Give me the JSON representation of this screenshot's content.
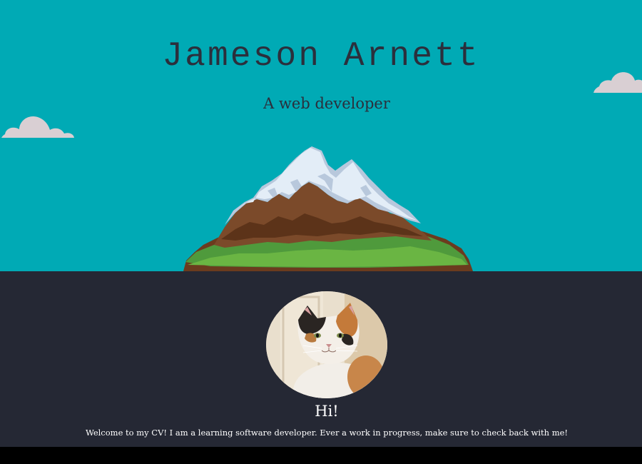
{
  "hero": {
    "name": "Jameson Arnett",
    "tagline": "A web developer",
    "background_color": "#00aab5",
    "decorations": [
      "cloud-icon",
      "cloud-icon",
      "mountain-illustration"
    ]
  },
  "about": {
    "avatar": "cat-photo",
    "greeting": "Hi!",
    "intro": "Welcome to my CV! I am a learning software developer. Ever a work in progress, make sure to check back with me!",
    "background_color": "#252834"
  }
}
